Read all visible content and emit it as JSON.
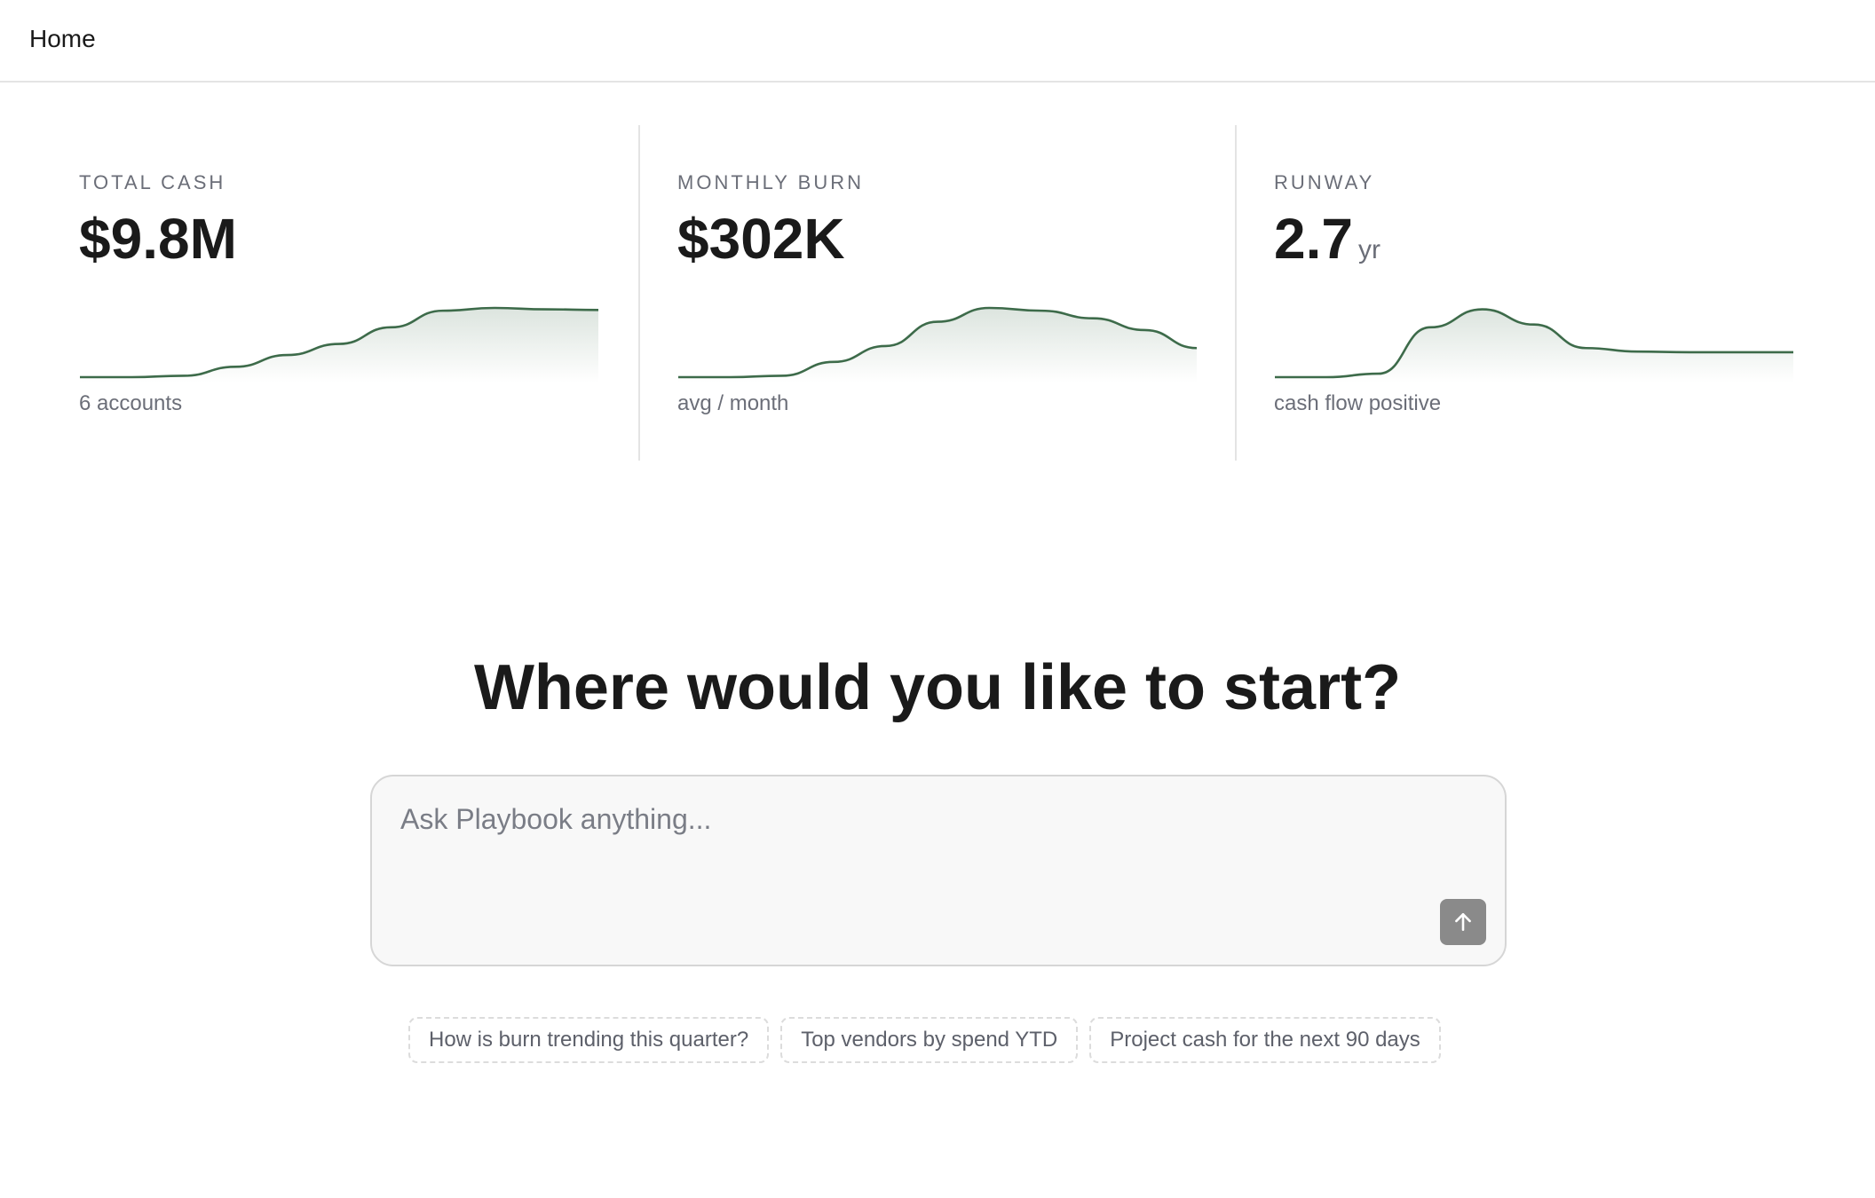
{
  "header": {
    "title": "Home"
  },
  "metrics": [
    {
      "label": "TOTAL CASH",
      "value": "$9.8M",
      "unit": "",
      "subtitle": "6 accounts",
      "trend": [
        0.0,
        0.0,
        0.02,
        0.15,
        0.32,
        0.48,
        0.72,
        0.96,
        1.0,
        0.98,
        0.97
      ],
      "line_color": "#3d6b4a"
    },
    {
      "label": "MONTHLY BURN",
      "value": "$302K",
      "unit": "",
      "subtitle": "avg / month",
      "trend": [
        0.0,
        0.0,
        0.02,
        0.22,
        0.45,
        0.8,
        1.0,
        0.96,
        0.85,
        0.68,
        0.42
      ],
      "line_color": "#3d6b4a"
    },
    {
      "label": "RUNWAY",
      "value": "2.7",
      "unit": "yr",
      "subtitle": "cash flow positive",
      "trend": [
        0.0,
        0.0,
        0.05,
        0.72,
        0.98,
        0.76,
        0.42,
        0.37,
        0.36,
        0.36,
        0.36
      ],
      "line_color": "#3d6b4a"
    }
  ],
  "main": {
    "heading": "Where would you like to start?",
    "composer": {
      "placeholder": "Ask Playbook anything..."
    },
    "send_icon": "arrow-up-icon",
    "suggestions": [
      "How is burn trending this quarter?",
      "Top vendors by spend YTD",
      "Project cash for the next 90 days"
    ]
  },
  "colors": {
    "accent_line": "#3d6b4a",
    "send_button": "#8a8a8a",
    "muted_text": "#6b6e78"
  }
}
